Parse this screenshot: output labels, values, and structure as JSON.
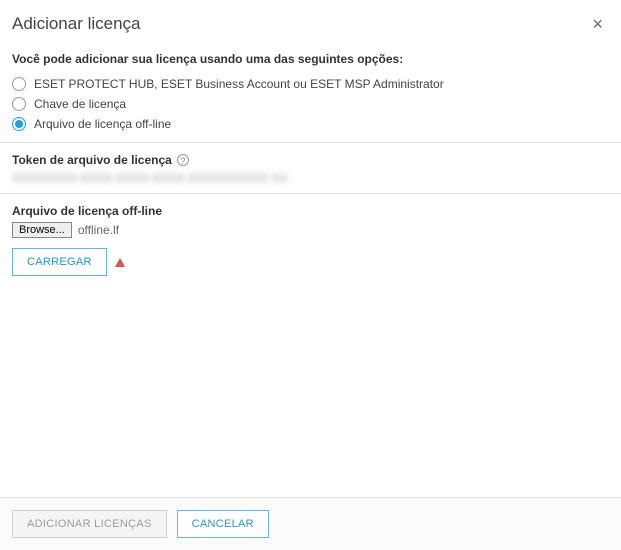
{
  "header": {
    "title": "Adicionar licença",
    "close_label": "×"
  },
  "intro": "Você pode adicionar sua licença usando uma das seguintes opções:",
  "radio_options": {
    "hub": "ESET PROTECT HUB, ESET Business Account ou ESET MSP Administrator",
    "key": "Chave de licença",
    "offline": "Arquivo de licença off-line"
  },
  "selected_option": "offline",
  "token_section": {
    "label": "Token de arquivo de licença",
    "help": "?",
    "value_masked": "XXXXXXXX-XXXX-XXXX-XXXX-XXXXXXXXXX XX"
  },
  "file_section": {
    "label": "Arquivo de licença off-line",
    "browse_button": "Browse...",
    "filename": "offline.lf",
    "upload_button": "CARREGAR",
    "warning": "!"
  },
  "footer": {
    "add_button": "ADICIONAR LICENÇAS",
    "cancel_button": "CANCELAR"
  }
}
